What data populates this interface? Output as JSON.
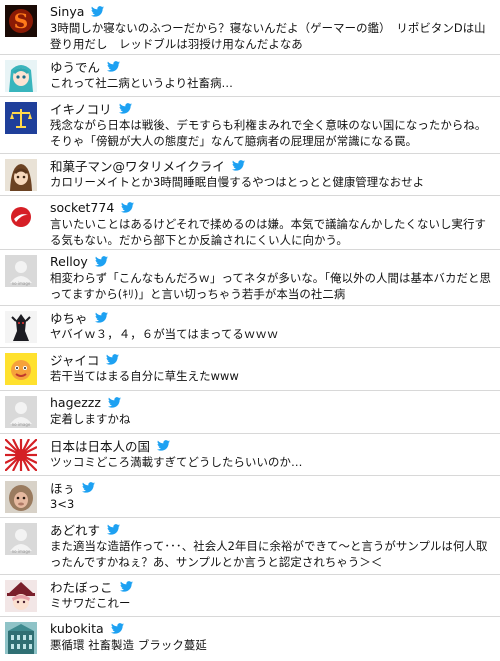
{
  "accent_color": "#1da1f2",
  "bird_icon": "twitter-bird-icon",
  "tweets": [
    {
      "user": "Sinya",
      "avatar": "red-s-logo",
      "text": "3時間しか寝ないのふつーだから？寝ないんだよ（ゲーマーの鑑）　リポビタンDは山登り用だし　レッドブルは羽授け用なんだよなあ"
    },
    {
      "user": "ゆうでん",
      "avatar": "anime-character-teal-hair",
      "text": "これって社二病というより社畜病…"
    },
    {
      "user": "イキノコリ",
      "avatar": "blue-scales-of-justice",
      "text": "残念ながら日本は戦後、デモすらも利権まみれで全く意味のない国になったからね。そりゃ「傍観が大人の態度だ」なんて臆病者の屁理屈が常識になる罠。"
    },
    {
      "user": "和菓子マン@ワタリメイクライ",
      "avatar": "brown-hair-character",
      "text": "カロリーメイトとか3時間睡眠自慢するやつはとっとと健康管理なおせよ"
    },
    {
      "user": "socket774",
      "avatar": "red-white-logo",
      "text": "言いたいことはあるけどそれで揉めるのは嫌。本気で議論なんかしたくないし実行する気もない。だから部下とか反論されにくい人に向かう。"
    },
    {
      "user": "Relloy",
      "avatar": "no-image-placeholder",
      "text": "相変わらず「こんなもんだろｗ」ってネタが多いな。「俺以外の人間は基本バカだと思ってますから(ｷﾘ)」と言い切っちゃう若手が本当の社二病"
    },
    {
      "user": "ゆちゃ",
      "avatar": "dark-armored-figure",
      "text": "ヤバイｗ３，４，６が当てはまってるｗｗｗ"
    },
    {
      "user": "ジャイコ",
      "avatar": "yellow-cartoon-face",
      "text": "若干当てはまる自分に草生えたwww"
    },
    {
      "user": "hagezzz",
      "avatar": "no-image-placeholder",
      "text": "定着しますかね"
    },
    {
      "user": "日本は日本人の国",
      "avatar": "rising-sun-flag",
      "text": "ツッコミどころ満載すぎてどうしたらいいのか…"
    },
    {
      "user": "ほぅ",
      "avatar": "monkey-photo",
      "text": "3<3"
    },
    {
      "user": "あどれす",
      "avatar": "no-image-placeholder",
      "text": "また適当な造語作って･･･、社会人2年目に余裕ができて～と言うがサンプルは何人取ったんですかねぇ？あ、サンプルとか言うと認定されちゃう＞＜"
    },
    {
      "user": "わたぼっこ",
      "avatar": "witch-hat-character",
      "text": "ミサワだこれー"
    },
    {
      "user": "kubokita",
      "avatar": "teal-building-photo",
      "text": "悪循環 社畜製造 ブラック蔓延"
    }
  ]
}
